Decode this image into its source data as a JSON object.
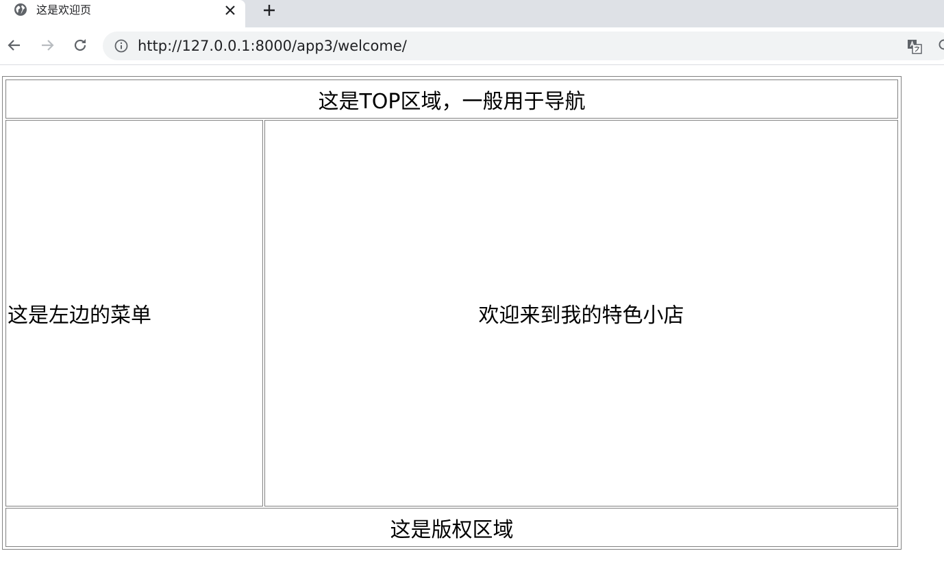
{
  "browser": {
    "tab": {
      "title": "这是欢迎页",
      "favicon": "globe-icon"
    },
    "new_tab": "plus-icon",
    "close_tab": "close-icon",
    "nav": {
      "back": "arrow-left-icon",
      "forward": "arrow-right-icon",
      "reload": "reload-icon"
    },
    "omnibox": {
      "info": "info-icon",
      "url": "http://127.0.0.1:8000/app3/welcome/",
      "translate": "translate-icon",
      "zoom": "zoom-icon"
    }
  },
  "page": {
    "top_text": "这是TOP区域，一般用于导航",
    "menu_text": "这是左边的菜单",
    "main_text": "欢迎来到我的特色小店",
    "footer_text": "这是版权区域"
  },
  "colors": {
    "border": "#808080",
    "tabstrip": "#dee1e6",
    "omnibox": "#f1f3f4",
    "icon": "#5f6368"
  }
}
